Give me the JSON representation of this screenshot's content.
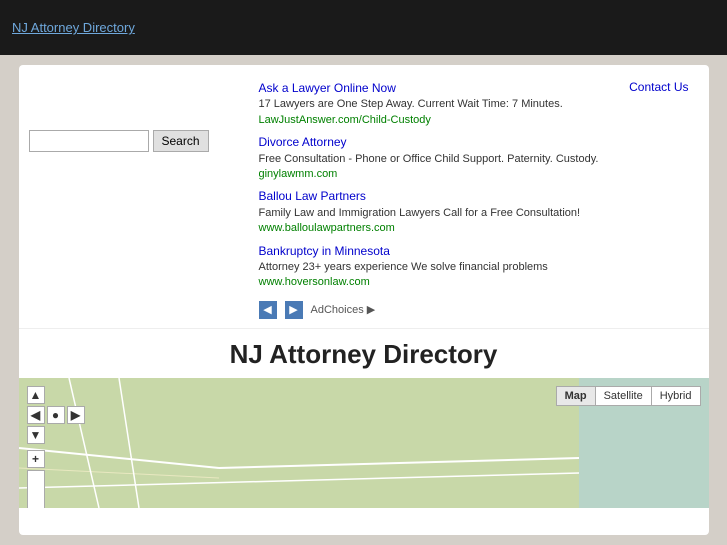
{
  "topbar": {
    "link_text": "NJ Attorney Directory",
    "url": "#"
  },
  "ads": [
    {
      "title": "Ask a Lawyer Online Now",
      "description": "17 Lawyers are One Step Away. Current Wait Time: 7 Minutes.",
      "url": "LawJustAnswer.com/Child-Custody"
    },
    {
      "title": "Divorce Attorney",
      "description": "Free Consultation - Phone or Office Child Support. Paternity. Custody.",
      "url": "ginylawmm.com"
    },
    {
      "title": "Ballou Law Partners",
      "description": "Family Law and Immigration Lawyers Call for a Free Consultation!",
      "url": "www.balloulaw partners.com"
    },
    {
      "title": "Bankruptcy in Minnesota",
      "description": "Attorney 23+ years experience We solve financial problems",
      "url": "www.hoversonlaw.com"
    }
  ],
  "contact_us_label": "Contact Us",
  "adchoices_label": "AdChoices",
  "page_title": "NJ Attorney Directory",
  "search_placeholder": "",
  "search_button_label": "Search",
  "map_controls": {
    "map_label": "Map",
    "satellite_label": "Satellite",
    "hybrid_label": "Hybrid"
  }
}
